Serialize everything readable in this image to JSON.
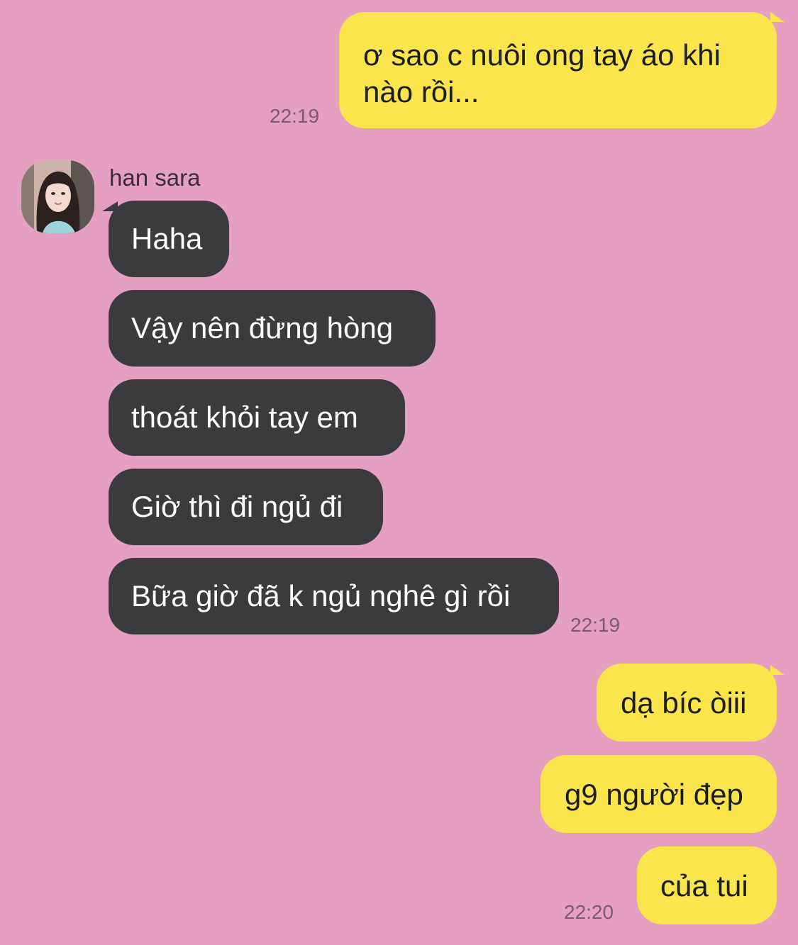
{
  "theme": {
    "background": "#e5a0c1",
    "outgoing_bubble": "#fbe54d",
    "incoming_bubble": "#3b3b3d"
  },
  "contact": {
    "name": "han sara",
    "avatar_icon": "profile-photo"
  },
  "messages": [
    {
      "direction": "outgoing",
      "text": "ơ sao c nuôi ong tay áo khi\nnào rồi...",
      "time": "22:19"
    },
    {
      "direction": "incoming",
      "text": "Haha"
    },
    {
      "direction": "incoming",
      "text": "Vậy nên đừng hòng"
    },
    {
      "direction": "incoming",
      "text": "thoát khỏi tay em"
    },
    {
      "direction": "incoming",
      "text": "Giờ thì đi ngủ đi"
    },
    {
      "direction": "incoming",
      "text": "Bữa giờ đã k ngủ nghê gì rồi",
      "time": "22:19"
    },
    {
      "direction": "outgoing",
      "text": "dạ bíc òiii"
    },
    {
      "direction": "outgoing",
      "text": "g9 người đẹp"
    },
    {
      "direction": "outgoing",
      "text": "của tui",
      "time": "22:20"
    }
  ]
}
